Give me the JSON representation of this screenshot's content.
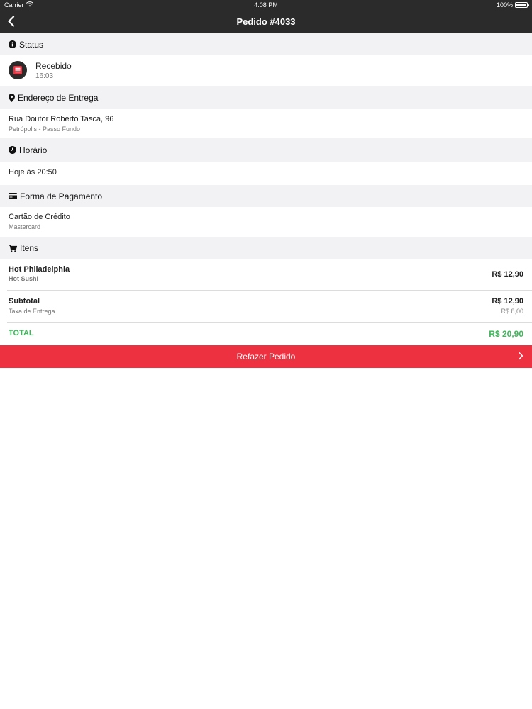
{
  "status_bar": {
    "carrier": "Carrier",
    "time": "4:08 PM",
    "battery": "100%"
  },
  "nav": {
    "title": "Pedido #4033"
  },
  "status": {
    "header": "Status",
    "state": "Recebido",
    "time": "16:03"
  },
  "address": {
    "header": "Endereço de Entrega",
    "street": "Rua Doutor Roberto Tasca, 96",
    "neighborhood": "Petrópolis - Passo Fundo"
  },
  "schedule": {
    "header": "Horário",
    "value": "Hoje às 20:50"
  },
  "payment": {
    "header": "Forma de Pagamento",
    "method": "Cartão de Crédito",
    "brand": "Mastercard"
  },
  "items": {
    "header": "Itens",
    "list": [
      {
        "name": "Hot Philadelphia",
        "category": "Hot Sushi",
        "price": "R$ 12,90"
      }
    ]
  },
  "summary": {
    "subtotal_label": "Subtotal",
    "subtotal_value": "R$ 12,90",
    "delivery_label": "Taxa de Entrega",
    "delivery_value": "R$ 8,00",
    "total_label": "TOTAL",
    "total_value": "R$ 20,90"
  },
  "actions": {
    "reorder_label": "Refazer Pedido"
  },
  "colors": {
    "bar": "#2b2b2b",
    "section": "#f2f2f4",
    "accent_red": "#ee3140",
    "total_green": "#3db85a"
  }
}
